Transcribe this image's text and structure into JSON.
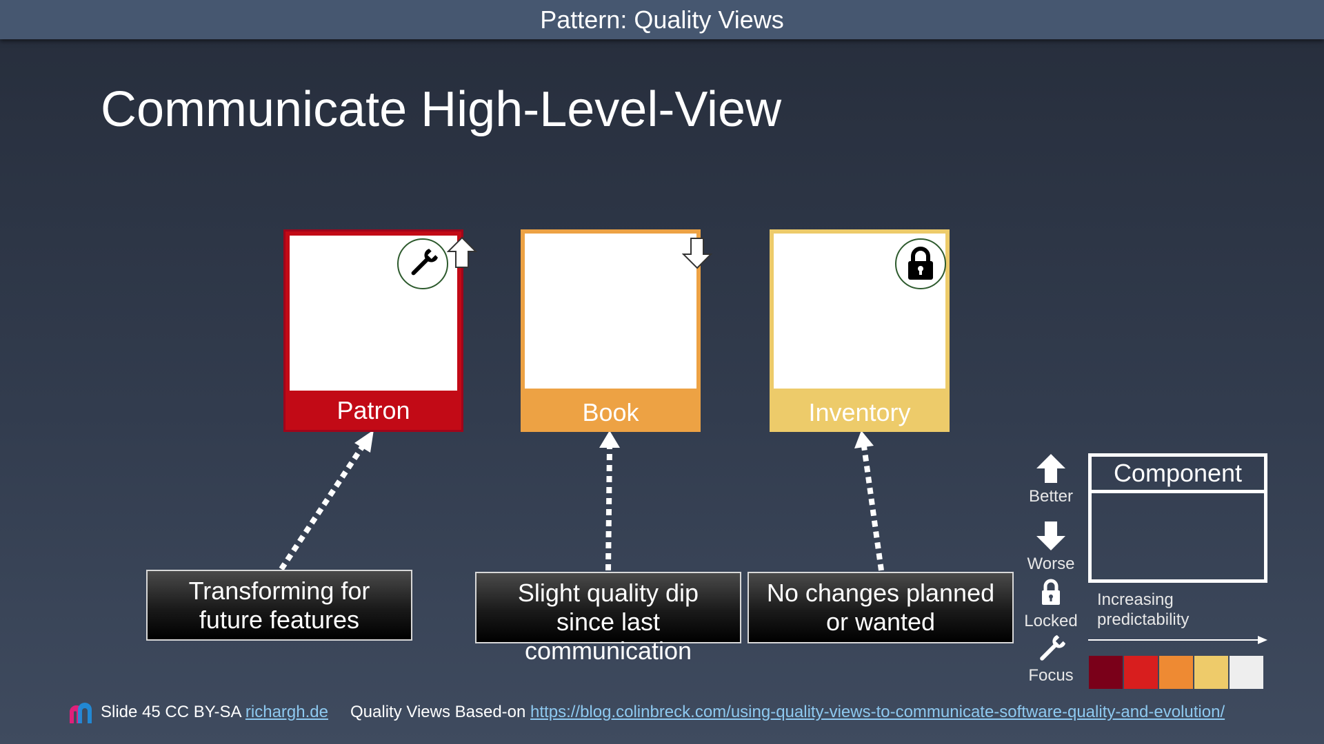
{
  "header": {
    "title": "Pattern: Quality Views"
  },
  "slide": {
    "title": "Communicate High-Level-View"
  },
  "components": [
    {
      "name": "Patron",
      "color": "#c20a16",
      "badge": "wrench-icon",
      "trend": "better"
    },
    {
      "name": "Book",
      "color": "#eda244",
      "badge": null,
      "trend": "worse"
    },
    {
      "name": "Inventory",
      "color": "#edcb6a",
      "badge": "lock-icon",
      "trend": null
    }
  ],
  "callouts": [
    {
      "line1": "Transforming for",
      "line2": "future features"
    },
    {
      "line1": "Slight quality dip",
      "line2": "since last",
      "line3": "communication"
    },
    {
      "line1": "No changes planned",
      "line2": "or wanted"
    }
  ],
  "legend": {
    "better": "Better",
    "worse": "Worse",
    "locked": "Locked",
    "focus": "Focus",
    "component_label": "Component",
    "predictability_line1": "Increasing",
    "predictability_line2": "predictability",
    "scale_colors": [
      "#7a0019",
      "#d81e1e",
      "#ee8a33",
      "#eecb6a",
      "#eeeeee"
    ]
  },
  "footer": {
    "slide_text": "Slide 45 CC BY-SA",
    "author_link": "richargh.de",
    "based_on_text": "Quality Views Based-on",
    "source_link": "https://blog.colinbreck.com/using-quality-views-to-communicate-software-quality-and-evolution/"
  }
}
